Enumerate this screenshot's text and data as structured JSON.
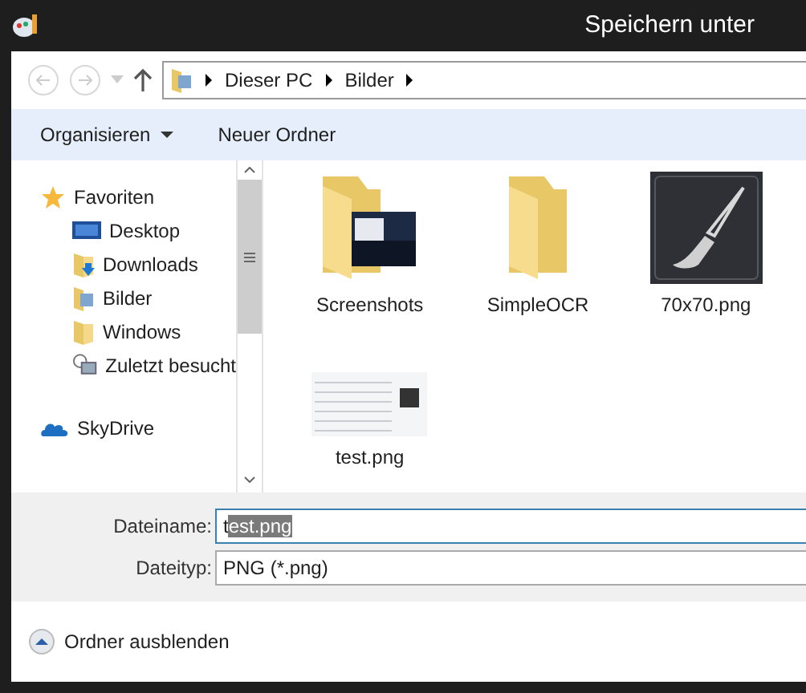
{
  "window": {
    "title": "Speichern unter"
  },
  "address_bar": {
    "crumbs": [
      "Dieser PC",
      "Bilder"
    ]
  },
  "toolbar": {
    "buttons": [
      {
        "label": "Organisieren",
        "kind": "menu"
      },
      {
        "label": "Neuer Ordner",
        "kind": "plain"
      }
    ]
  },
  "sidebar": {
    "groups": [
      {
        "label": "Favoriten",
        "kind": "star",
        "children": [
          {
            "label": "Desktop",
            "kind": "desktop"
          },
          {
            "label": "Downloads",
            "kind": "downloads"
          },
          {
            "label": "Bilder",
            "kind": "pictures"
          },
          {
            "label": "Windows",
            "kind": "folder"
          },
          {
            "label": "Zuletzt besucht",
            "kind": "recent"
          }
        ]
      },
      {
        "label": "SkyDrive",
        "kind": "cloud"
      }
    ]
  },
  "files": [
    {
      "name": "Screenshots",
      "kind": "screenshot-folder"
    },
    {
      "name": "SimpleOCR",
      "kind": "folder"
    },
    {
      "name": "70x70.png",
      "kind": "brush-image"
    },
    {
      "name": "test.png",
      "kind": "table-image"
    }
  ],
  "form": {
    "filename_label": "Dateiname:",
    "filename_parts": [
      {
        "text": "t",
        "selected": false
      },
      {
        "text": "est.png",
        "selected": true
      }
    ],
    "filetype_label": "Dateityp:",
    "filetype": "PNG (*.png)"
  },
  "footer": {
    "toggle": "Ordner ausblenden"
  }
}
